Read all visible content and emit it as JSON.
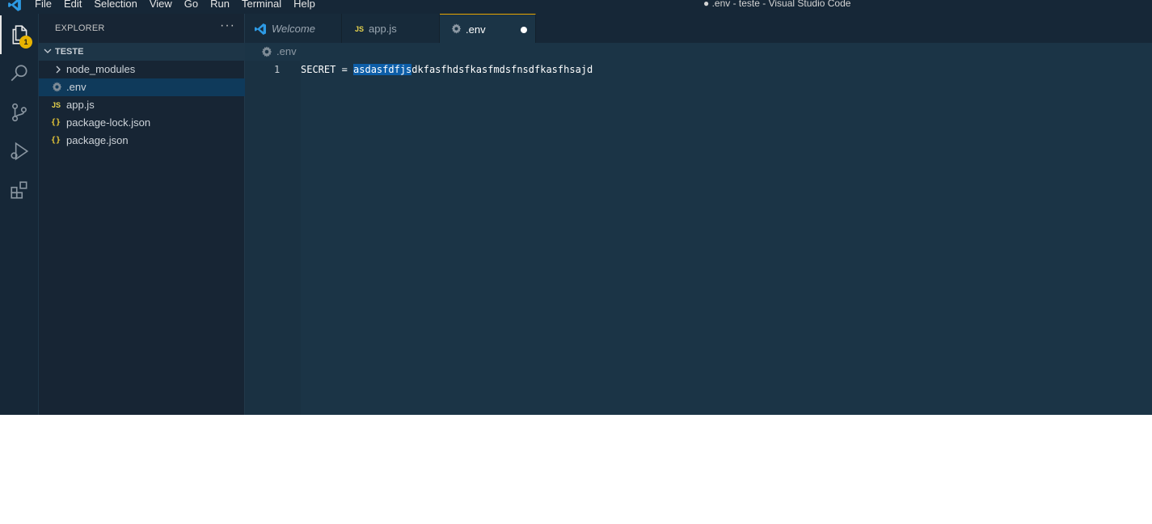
{
  "titlebar": {
    "menu": [
      "File",
      "Edit",
      "Selection",
      "View",
      "Go",
      "Run",
      "Terminal",
      "Help"
    ],
    "window_title": "● .env - teste - Visual Studio Code"
  },
  "activitybar": {
    "items": [
      "explorer-icon",
      "search-icon",
      "source-control-icon",
      "run-debug-icon",
      "extensions-icon"
    ],
    "explorer_badge": "1"
  },
  "sidebar": {
    "title": "EXPLORER",
    "more": "···",
    "folder": "TESTE",
    "items": [
      {
        "label": "node_modules",
        "icon": "chevron-right-icon"
      },
      {
        "label": ".env",
        "icon": "gear-icon",
        "selected": true
      },
      {
        "label": "app.js",
        "icon": "js-icon",
        "icon_text": "JS"
      },
      {
        "label": "package-lock.json",
        "icon": "json-icon",
        "icon_text": "{}"
      },
      {
        "label": "package.json",
        "icon": "json-icon",
        "icon_text": "{}"
      }
    ]
  },
  "tabs": [
    {
      "label": "Welcome",
      "icon": "vscode-icon"
    },
    {
      "label": "app.js",
      "icon": "js-icon",
      "icon_text": "JS"
    },
    {
      "label": ".env",
      "icon": "gear-icon",
      "active": true,
      "dirty": true
    }
  ],
  "breadcrumb": {
    "file": ".env"
  },
  "editor": {
    "line_number": "1",
    "prefix": "SECRET = ",
    "selected": "asdasfdfjs",
    "rest": "dkfasfhdsfkasfmdsfnsdfkasfhsajd"
  },
  "colors": {
    "accent": "#e7a500",
    "badge": "#e8b300",
    "selection": "#0d5ea8",
    "editor_bg": "#1b3446"
  }
}
